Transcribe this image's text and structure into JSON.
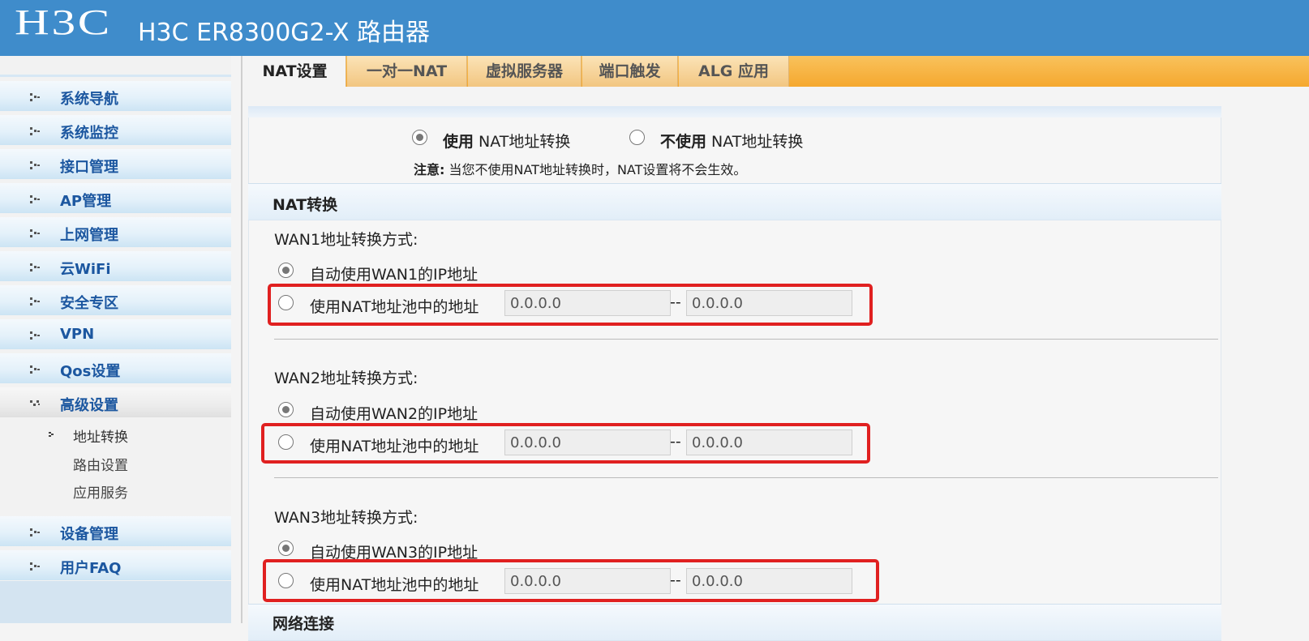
{
  "header": {
    "brand": "H3C",
    "title": "H3C ER8300G2-X 路由器"
  },
  "sidebar": {
    "menu": [
      {
        "label": "系统导航"
      },
      {
        "label": "系统监控"
      },
      {
        "label": "接口管理"
      },
      {
        "label": "AP管理"
      },
      {
        "label": "上网管理"
      },
      {
        "label": "云WiFi"
      },
      {
        "label": "安全专区"
      },
      {
        "label": "VPN"
      },
      {
        "label": "Qos设置"
      },
      {
        "label": "高级设置",
        "expanded": true
      },
      {
        "label": "设备管理"
      },
      {
        "label": "用户FAQ"
      }
    ],
    "submenu": [
      {
        "label": "地址转换",
        "active": true
      },
      {
        "label": "路由设置"
      },
      {
        "label": "应用服务"
      }
    ]
  },
  "tabs": [
    {
      "label": "NAT设置",
      "active": true
    },
    {
      "label": "一对一NAT"
    },
    {
      "label": "虚拟服务器"
    },
    {
      "label": "端口触发"
    },
    {
      "label": "ALG 应用"
    }
  ],
  "nat_mode": {
    "use_bold": "使用",
    "use_rest": " NAT地址转换",
    "nouse_bold": "不使用",
    "nouse_rest": " NAT地址转换",
    "selected": "use",
    "note_label": "注意:",
    "note_text": "当您不使用NAT地址转换时，NAT设置将不会生效。"
  },
  "nat_section": {
    "title": "NAT转换",
    "wans": [
      {
        "label": "WAN1地址转换方式:",
        "auto_label": "自动使用WAN1的IP地址",
        "pool_label": "使用NAT地址池中的地址",
        "pool_start": "0.0.0.0",
        "pool_end": "0.0.0.0",
        "selected": "auto"
      },
      {
        "label": "WAN2地址转换方式:",
        "auto_label": "自动使用WAN2的IP地址",
        "pool_label": "使用NAT地址池中的地址",
        "pool_start": "0.0.0.0",
        "pool_end": "0.0.0.0",
        "selected": "auto"
      },
      {
        "label": "WAN3地址转换方式:",
        "auto_label": "自动使用WAN3的IP地址",
        "pool_label": "使用NAT地址池中的地址",
        "pool_start": "0.0.0.0",
        "pool_end": "0.0.0.0",
        "selected": "auto"
      }
    ],
    "separator": "--"
  },
  "next_section": {
    "title": "网络连接"
  },
  "colors": {
    "header_bg": "#3f8ccb",
    "tab_bar": "#f5a82f",
    "menu_text": "#1c57a0",
    "highlight": "#e02020"
  }
}
